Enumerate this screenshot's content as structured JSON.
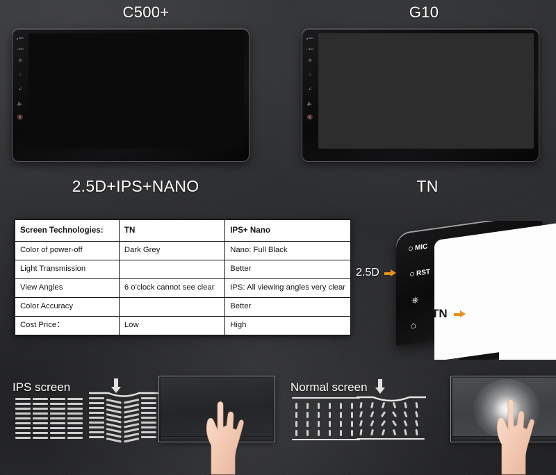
{
  "theme": {
    "background": "#2f3032",
    "accent_orange": "#e8901a",
    "table_bg": "#ffffff",
    "table_text": "#141414",
    "ips_screen_color": "#0c0c0c",
    "tn_screen_color": "#2d2d2d"
  },
  "devices": [
    {
      "title": "C500+",
      "subtitle": "2.5D+IPS+NANO",
      "screen_color": "#0b0b0b",
      "buttons": [
        "MIC",
        "RST",
        "power",
        "home",
        "back",
        "vol-up",
        "vol-down"
      ]
    },
    {
      "title": "G10",
      "subtitle": "TN",
      "screen_color": "#2d2d2d",
      "buttons": [
        "MIC",
        "RST",
        "power",
        "home",
        "back",
        "vol-up",
        "vol-down"
      ]
    }
  ],
  "comparison_table": {
    "header": [
      "Screen Technologies:",
      "TN",
      "IPS+ Nano"
    ],
    "rows": [
      [
        "Color of power-off",
        "Dark Grey",
        "Nano: Full Black"
      ],
      [
        "Light Transmission",
        "",
        "Better"
      ],
      [
        "View Angles",
        "6 o'clock cannot see clear",
        "IPS: All viewing angles very clear"
      ],
      [
        "Color Accuracy",
        "",
        "Better"
      ],
      [
        "Cost Price：",
        "Low",
        "High"
      ]
    ]
  },
  "edge_panel": {
    "label_25d": "2.5D",
    "label_tn": "TN",
    "front_plate_keys": [
      "MIC",
      "RST"
    ],
    "back_plate_keys": [
      "MIC",
      "RST"
    ]
  },
  "bottom": {
    "left": {
      "label": "IPS screen",
      "crystal_orientation": "horizontal",
      "pressed_effect": "bars bend inward, no light leak",
      "monitor_glow": false
    },
    "right": {
      "label": "Normal screen",
      "crystal_orientation": "vertical",
      "pressed_effect": "crystals skew, light leaks through",
      "monitor_glow": true
    }
  }
}
